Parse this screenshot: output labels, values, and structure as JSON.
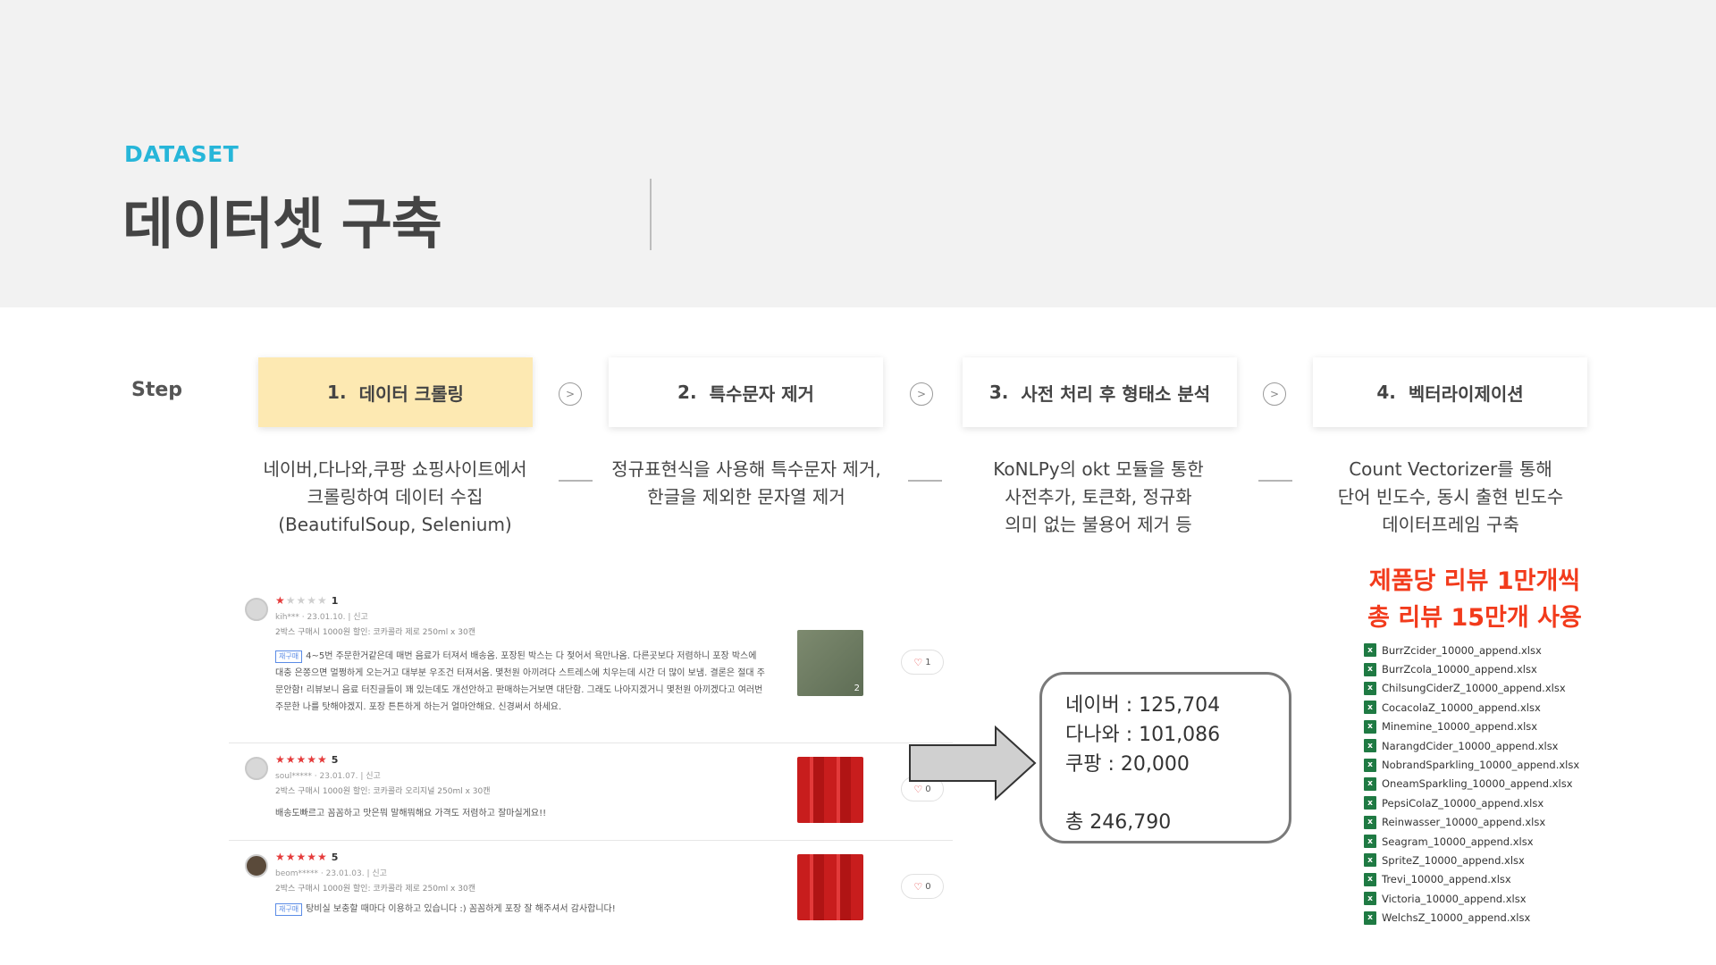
{
  "header": {
    "eyebrow": "DATASET",
    "title": "데이터셋 구축"
  },
  "steps": {
    "label": "Step",
    "items": [
      {
        "num": "1.",
        "label": "데이터 크롤링",
        "active": true,
        "desc": [
          "네이버,다나와,쿠팡 쇼핑사이트에서",
          "크롤링하여 데이터 수집",
          "(BeautifulSoup, Selenium)"
        ]
      },
      {
        "num": "2.",
        "label": "특수문자 제거",
        "active": false,
        "desc": [
          "정규표현식을 사용해 특수문자 제거,",
          "한글을 제외한 문자열 제거"
        ]
      },
      {
        "num": "3.",
        "label": "사전 처리 후 형태소 분석",
        "active": false,
        "desc": [
          "KoNLPy의 okt 모듈을 통한",
          "사전추가, 토큰화, 정규화",
          "의미 없는 불용어 제거 등"
        ]
      },
      {
        "num": "4.",
        "label": "벡터라이제이션",
        "active": false,
        "desc": [
          "Count Vectorizer를 통해",
          "단어 빈도수, 동시 출현 빈도수",
          "데이터프레임 구축"
        ]
      }
    ],
    "chevron": ">"
  },
  "reviews": [
    {
      "stars_on": "★",
      "stars_off": "★★★★",
      "rating": "1",
      "user": "kih***",
      "date": "23.01.10.",
      "report": "신고",
      "option": "2박스 구매시 1000원 할인: 코카콜라 제로 250ml x 30캔",
      "tag": "재구매",
      "text": "4~5번 주문한거같은데 매번 음료가 터져서 배송옴. 포장된 박스는 다 젖어서 욕만나옴. 다른곳보다 저렴하니 포장 박스에 대충 은쫑으면 멀쩡하게 오는거고 대부분 우조건 터져서옴. 몇천원 아끼려다 스트레스에 치우는데 시간 더 많이 보냄. 결론은 절대 주문안함! 리뷰보니 음료 터진글들이 꽤 있는데도 개선안하고 판매하는거보면 대단함. 그래도 나아지겠거니 몇천원 아끼겠다고 여러번 주문한 나를 탓해야겠지. 포장 튼튼하게 하는거 얼마안해요. 신경써서 하세요.",
      "photo_count": "2",
      "likes": "1"
    },
    {
      "stars_on": "★★★★★",
      "stars_off": "",
      "rating": "5",
      "user": "soul*****",
      "date": "23.01.07.",
      "report": "신고",
      "option": "2박스 구매시 1000원 할인: 코카콜라 오리지널 250ml x 30캔",
      "tag": "",
      "text": "배송도빠르고 꼼꼼하고 맛은뭐 말해뭐해요 가격도 저렴하고 잘마실게요!!",
      "photo_count": "",
      "likes": "0"
    },
    {
      "stars_on": "★★★★★",
      "stars_off": "",
      "rating": "5",
      "user": "beom*****",
      "date": "23.01.03.",
      "report": "신고",
      "option": "2박스 구매시 1000원 할인: 코카콜라 제로 250ml x 30캔",
      "tag": "재구매",
      "text": "탕비실 보충할 때마다 이용하고 있습니다 :) 꼼꼼하게 포장 잘 해주셔서 감사합니다!",
      "photo_count": "",
      "likes": "0"
    }
  ],
  "counts": {
    "naver": "네이버 : 125,704",
    "danawa": "다나와 : 101,086",
    "coupang": "쿠팡 : 20,000",
    "total": "총 246,790"
  },
  "highlight": {
    "line1": "제품당 리뷰 1만개씩",
    "line2": "총 리뷰 15만개 사용"
  },
  "files": [
    "BurrZcider_10000_append.xlsx",
    "BurrZcola_10000_append.xlsx",
    "ChilsungCiderZ_10000_append.xlsx",
    "CocacolaZ_10000_append.xlsx",
    "Minemine_10000_append.xlsx",
    "NarangdCider_10000_append.xlsx",
    "NobrandSparkling_10000_append.xlsx",
    "OneamSparkling_10000_append.xlsx",
    "PepsiColaZ_10000_append.xlsx",
    "Reinwasser_10000_append.xlsx",
    "Seagram_10000_append.xlsx",
    "SpriteZ_10000_append.xlsx",
    "Trevi_10000_append.xlsx",
    "Victoria_10000_append.xlsx",
    "WelchsZ_10000_append.xlsx"
  ],
  "colors": {
    "accent": "#27b6d9",
    "active_step": "#fde9b2",
    "highlight": "#f23b1c",
    "excel": "#1f7a43"
  }
}
